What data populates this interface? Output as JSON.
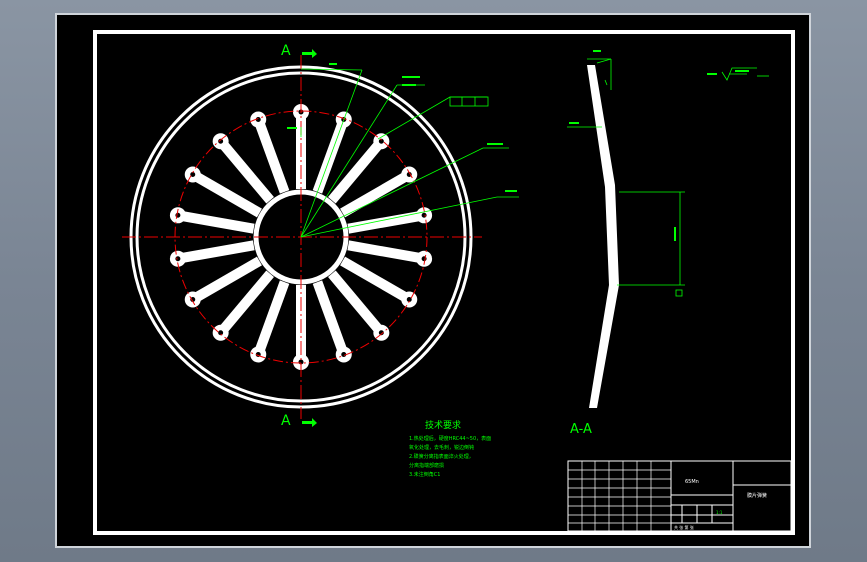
{
  "drawing": {
    "section_marks": {
      "top": "A",
      "bottom": "A"
    },
    "section_view_label": "A-A",
    "tech_requirements": {
      "title": "技术要求",
      "lines": [
        "1.热处理后，硬度HRC44~50，表面",
        "氧化处理，去毛刺，锐边倒钝",
        "2.碟簧分离指表面淬火处理，",
        "分离指端部磨损",
        "3.未注倒角C1"
      ]
    },
    "title_block": {
      "material": "65Mn",
      "part_name": "膜片弹簧",
      "scale": "1:1",
      "sheet": "共 张 第 张"
    },
    "colors": {
      "paper": "#000000",
      "frame": "#ffffff",
      "part": "#ffffff",
      "centerline": "#ff0000",
      "dimension": "#00ff00"
    }
  }
}
